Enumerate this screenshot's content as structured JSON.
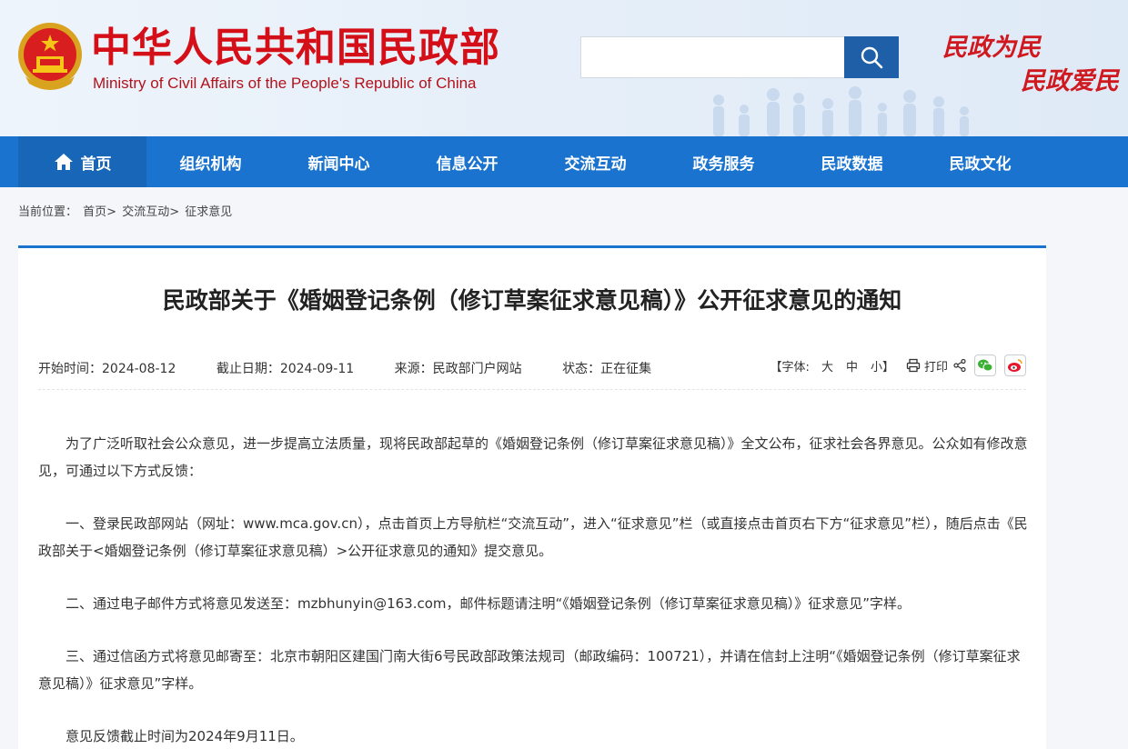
{
  "header": {
    "site_name": "中华人民共和国民政部",
    "site_name_en": "Ministry of Civil Affairs of the People's Republic of China",
    "slogan_line1": "民政为民",
    "slogan_line2": "民政爱民",
    "search": {
      "value": "",
      "placeholder": ""
    }
  },
  "nav": {
    "items": [
      {
        "label": "首页"
      },
      {
        "label": "组织机构"
      },
      {
        "label": "新闻中心"
      },
      {
        "label": "信息公开"
      },
      {
        "label": "交流互动"
      },
      {
        "label": "政务服务"
      },
      {
        "label": "民政数据"
      },
      {
        "label": "民政文化"
      }
    ]
  },
  "breadcrumb": {
    "prefix": "当前位置：",
    "items": [
      "首页>",
      "交流互动>",
      "征求意见"
    ]
  },
  "article": {
    "title": "民政部关于《婚姻登记条例（修订草案征求意见稿）》公开征求意见的通知",
    "meta": {
      "start": "开始时间：2024-08-12",
      "end": "截止日期：2024-09-11",
      "source": "来源：民政部门户网站",
      "status": "状态：正在征集"
    },
    "tools": {
      "font_label": "【字体:",
      "font_large": "大",
      "font_medium": "中",
      "font_small": "小】",
      "print_label": "打印"
    },
    "paragraphs": [
      "为了广泛听取社会公众意见，进一步提高立法质量，现将民政部起草的《婚姻登记条例（修订草案征求意见稿）》全文公布，征求社会各界意见。公众如有修改意见，可通过以下方式反馈：",
      "一、登录民政部网站（网址：www.mca.gov.cn），点击首页上方导航栏“交流互动”，进入“征求意见”栏（或直接点击首页右下方“征求意见”栏），随后点击《民政部关于<婚姻登记条例（修订草案征求意见稿）>公开征求意见的通知》提交意见。",
      "二、通过电子邮件方式将意见发送至：mzbhunyin@163.com，邮件标题请注明“《婚姻登记条例（修订草案征求意见稿）》征求意见”字样。",
      "三、通过信函方式将意见邮寄至：北京市朝阳区建国门南大街6号民政部政策法规司（邮政编码：100721），并请在信封上注明“《婚姻登记条例（修订草案征求意见稿）》征求意见”字样。",
      "意见反馈截止时间为2024年9月11日。"
    ]
  },
  "colors": {
    "brand_red": "#d40f17",
    "nav_blue": "#1a73cf",
    "search_blue": "#1f5fa8"
  }
}
